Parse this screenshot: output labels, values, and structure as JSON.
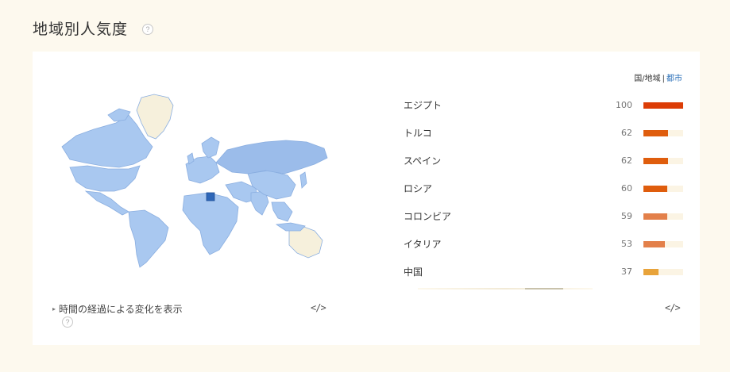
{
  "header": {
    "title": "地域別人気度",
    "help": "?"
  },
  "toggle": {
    "country_label": "国/地域",
    "separator": "|",
    "city_label": "都市"
  },
  "timeline": {
    "label": "時間の経過による変化を表示",
    "caret": "▸",
    "help": "?"
  },
  "embed": {
    "left": "</>",
    "right": "</>"
  },
  "ranking": [
    {
      "name": "エジプト",
      "value": 100,
      "color": "#dc3d06"
    },
    {
      "name": "トルコ",
      "value": 62,
      "color": "#df5d0d"
    },
    {
      "name": "スペイン",
      "value": 62,
      "color": "#df5d0d"
    },
    {
      "name": "ロシア",
      "value": 60,
      "color": "#df5d0d"
    },
    {
      "name": "コロンビア",
      "value": 59,
      "color": "#e3804a"
    },
    {
      "name": "イタリア",
      "value": 53,
      "color": "#e3804a"
    },
    {
      "name": "中国",
      "value": 37,
      "color": "#e8a33a"
    }
  ],
  "map_colors": {
    "land": "#a9c8f0",
    "border": "#8aaee0",
    "no_data": "#f6f0dc",
    "russia": "#9bbcea",
    "egypt": "#2d66b8"
  }
}
